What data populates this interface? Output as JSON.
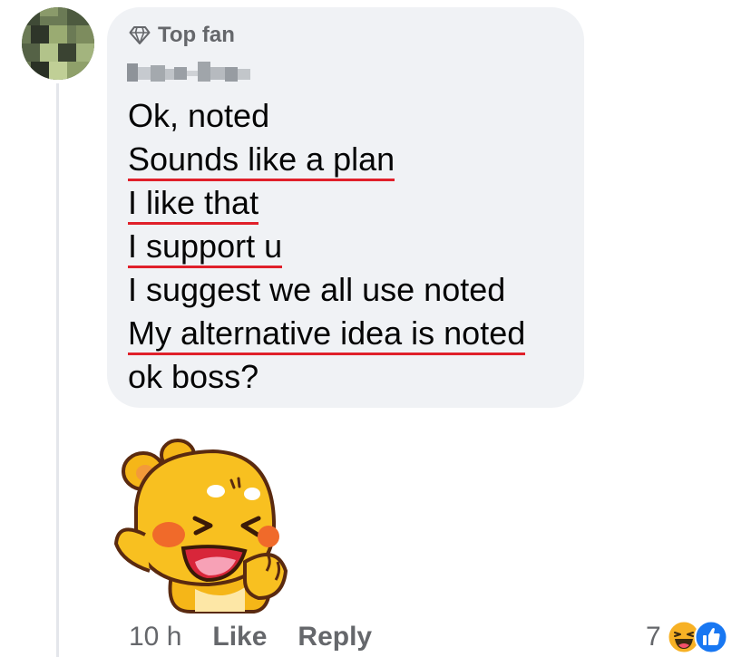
{
  "comment": {
    "badge_icon": "diamond-icon",
    "badge_label": "Top fan",
    "author_name_redacted": true,
    "lines": [
      {
        "text": "Ok, noted",
        "underlined": false
      },
      {
        "text": "Sounds like a plan",
        "underlined": true
      },
      {
        "text": "I like that",
        "underlined": true
      },
      {
        "text": "I support u",
        "underlined": true
      },
      {
        "text": "I suggest we all use noted",
        "underlined": false
      },
      {
        "text": "My alternative idea is noted",
        "underlined": true
      },
      {
        "text": "ok boss?",
        "underlined": false
      }
    ],
    "underline_color": "#e0202a"
  },
  "sticker": {
    "icon": "laughing-bear-sticker-icon"
  },
  "footer": {
    "time": "10 h",
    "like_label": "Like",
    "reply_label": "Reply",
    "reaction_count": "7",
    "reaction_icons": [
      "haha-icon",
      "like-icon"
    ]
  },
  "colors": {
    "bubble": "#f0f2f5",
    "secondary_text": "#65676b",
    "like_blue": "#1877f2",
    "haha_yellow": "#f7b125"
  }
}
